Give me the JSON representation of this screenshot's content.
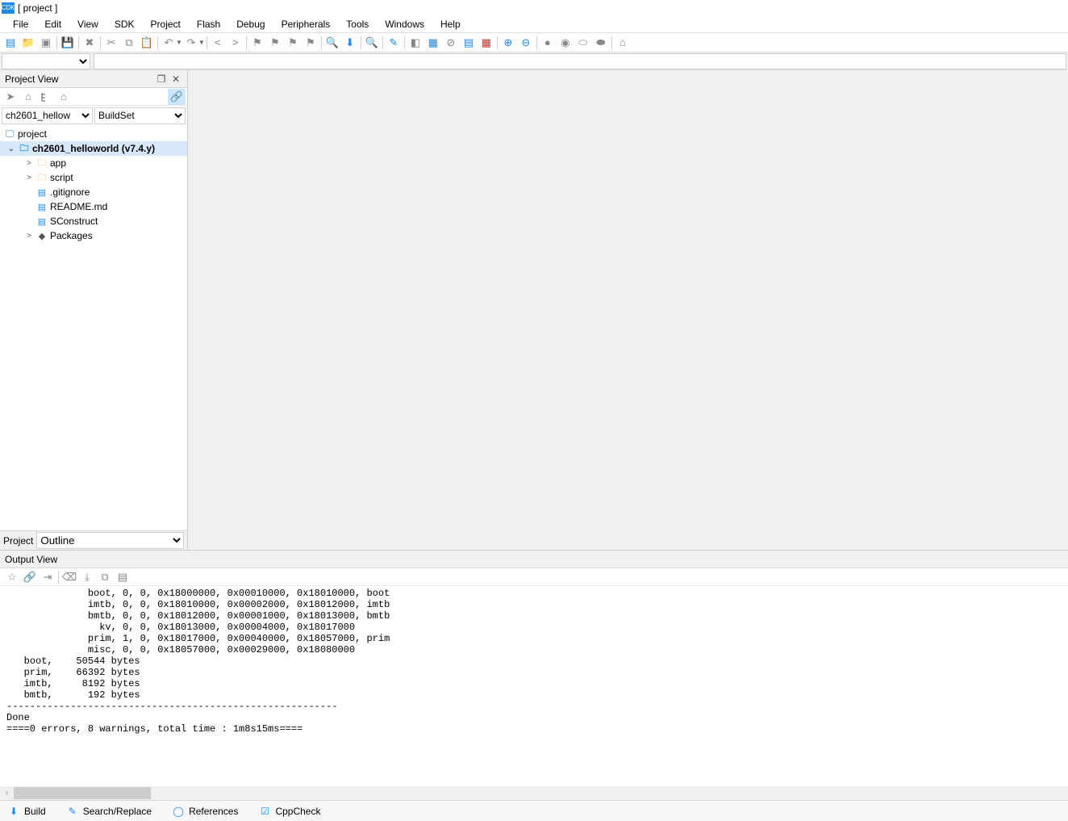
{
  "title": "[ project ]",
  "menu": [
    "File",
    "Edit",
    "View",
    "SDK",
    "Project",
    "Flash",
    "Debug",
    "Peripherals",
    "Tools",
    "Windows",
    "Help"
  ],
  "project_view": {
    "title": "Project View",
    "select1": "ch2601_hellow",
    "select2": "BuildSet",
    "footer_label": "Project",
    "footer_select": "Outline",
    "tree": {
      "root": "project",
      "root_child": "ch2601_helloworld (v7.4.y)",
      "items": [
        {
          "label": "app",
          "type": "folder",
          "exp": ">",
          "indent": 30
        },
        {
          "label": "script",
          "type": "folder",
          "exp": ">",
          "indent": 30
        },
        {
          "label": ".gitignore",
          "type": "file",
          "exp": "",
          "indent": 42
        },
        {
          "label": "README.md",
          "type": "file",
          "exp": "",
          "indent": 42
        },
        {
          "label": "SConstruct",
          "type": "file",
          "exp": "",
          "indent": 42
        },
        {
          "label": "Packages",
          "type": "pkg",
          "exp": ">",
          "indent": 30
        }
      ]
    }
  },
  "output_view": {
    "title": "Output View",
    "text": "              boot, 0, 0, 0x18000000, 0x00010000, 0x18010000, boot\n              imtb, 0, 0, 0x18010000, 0x00002000, 0x18012000, imtb\n              bmtb, 0, 0, 0x18012000, 0x00001000, 0x18013000, bmtb\n                kv, 0, 0, 0x18013000, 0x00004000, 0x18017000\n              prim, 1, 0, 0x18017000, 0x00040000, 0x18057000, prim\n              misc, 0, 0, 0x18057000, 0x00029000, 0x18080000\n   boot,    50544 bytes\n   prim,    66392 bytes\n   imtb,     8192 bytes\n   bmtb,      192 bytes\n---------------------------------------------------------\nDone\n====0 errors, 8 warnings, total time : 1m8s15ms===="
  },
  "bottom_tabs": {
    "build": "Build",
    "search": "Search/Replace",
    "references": "References",
    "cppcheck": "CppCheck"
  }
}
